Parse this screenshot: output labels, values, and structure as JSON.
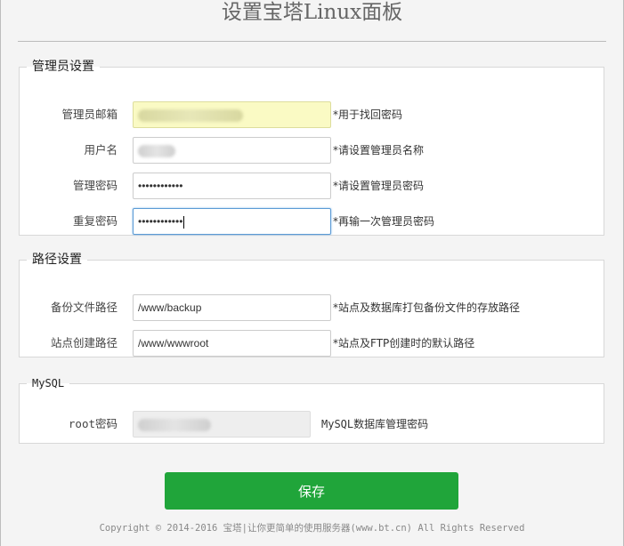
{
  "page": {
    "title": "设置宝塔Linux面板"
  },
  "admin": {
    "legend": "管理员设置",
    "fields": [
      {
        "label": "管理员邮箱",
        "value": "",
        "hint": "*用于找回密码"
      },
      {
        "label": "用户名",
        "value": "",
        "hint": "*请设置管理员名称"
      },
      {
        "label": "管理密码",
        "value": "••••••••••••",
        "hint": "*请设置管理员密码"
      },
      {
        "label": "重复密码",
        "value": "••••••••••••",
        "hint": "*再输一次管理员密码"
      }
    ]
  },
  "paths": {
    "legend": "路径设置",
    "fields": [
      {
        "label": "备份文件路径",
        "value": "/www/backup",
        "hint": "*站点及数据库打包备份文件的存放路径"
      },
      {
        "label": "站点创建路径",
        "value": "/www/wwwroot",
        "hint": "*站点及FTP创建时的默认路径"
      }
    ]
  },
  "mysql": {
    "legend": "MySQL",
    "fields": [
      {
        "label": "root密码",
        "value": "",
        "hint": "MySQL数据库管理密码"
      }
    ]
  },
  "buttons": {
    "save": "保存"
  },
  "footer": {
    "text": "Copyright © 2014-2016 宝塔|让你更简单的使用服务器(www.bt.cn) All Rights Reserved"
  },
  "colors": {
    "primary": "#20a53a",
    "email_field_bg": "#fafac4",
    "focus_border": "#5b9bd5"
  }
}
